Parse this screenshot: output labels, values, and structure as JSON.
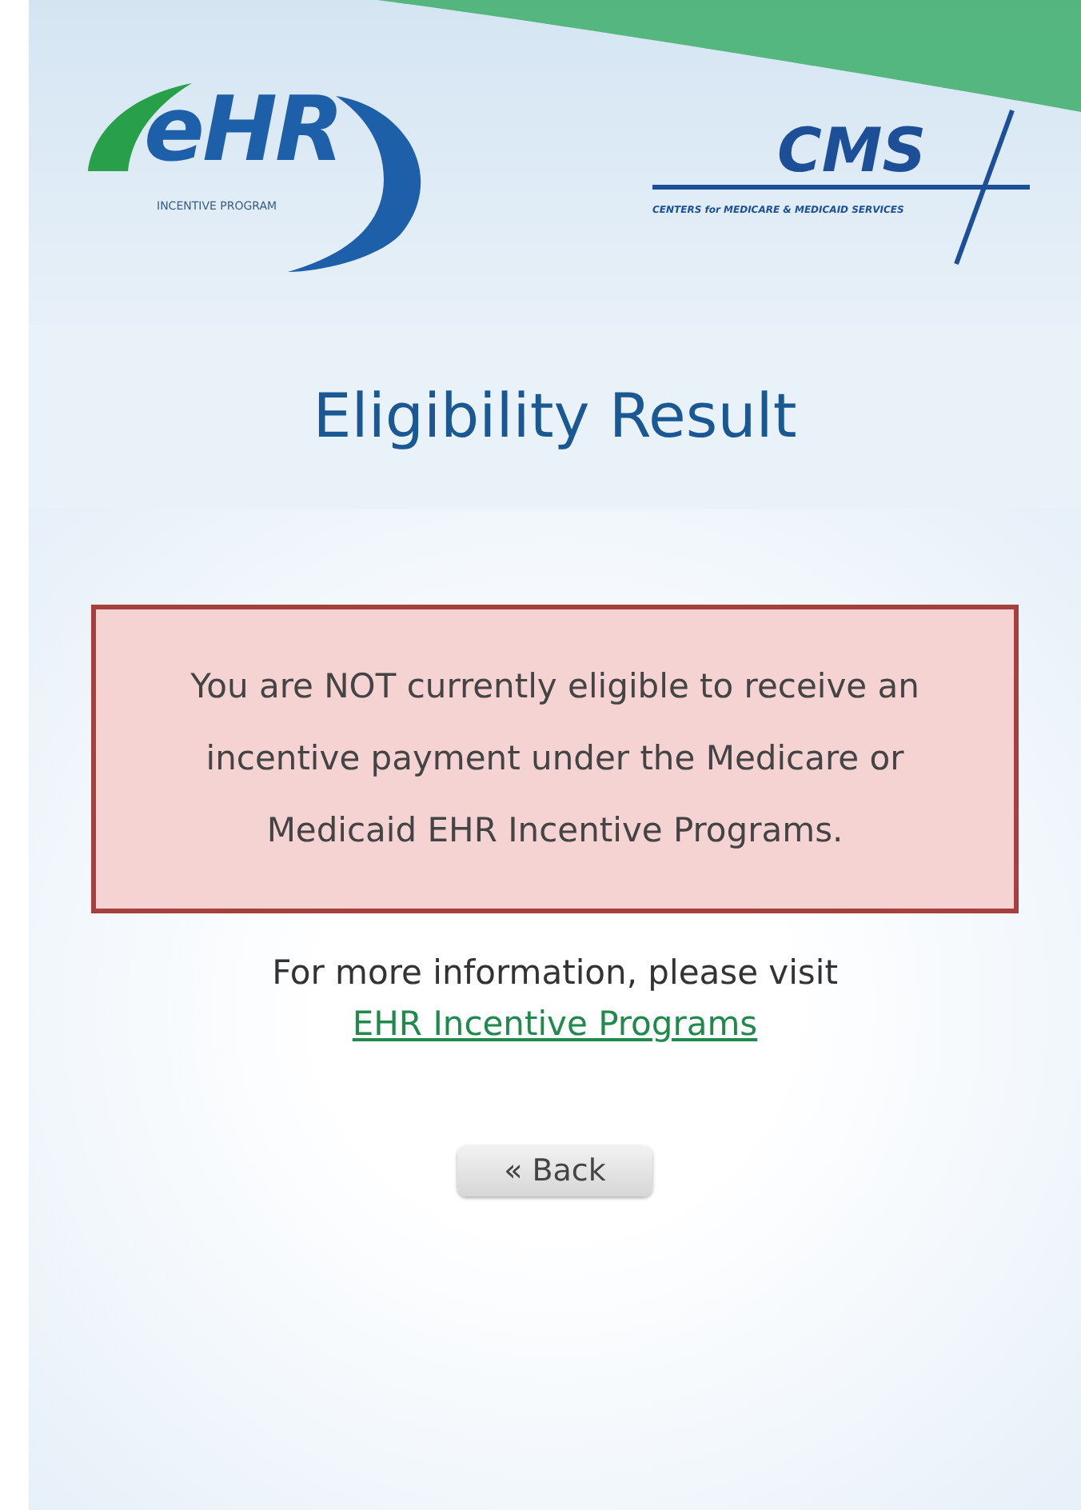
{
  "header": {
    "ehr_logo": {
      "mark": "eHR",
      "caption": "INCENTIVE PROGRAM"
    },
    "cms_logo": {
      "mark": "CMS",
      "caption": "CENTERS for MEDICARE & MEDICAID SERVICES"
    }
  },
  "title": "Eligibility Result",
  "alert": {
    "kind": "error",
    "message": "You are NOT currently eligible to receive an incentive payment under the Medicare or Medicaid EHR Incentive Programs."
  },
  "info": {
    "text": "For more information, please visit",
    "link": "EHR Incentive Programs"
  },
  "back_button": "« Back"
}
